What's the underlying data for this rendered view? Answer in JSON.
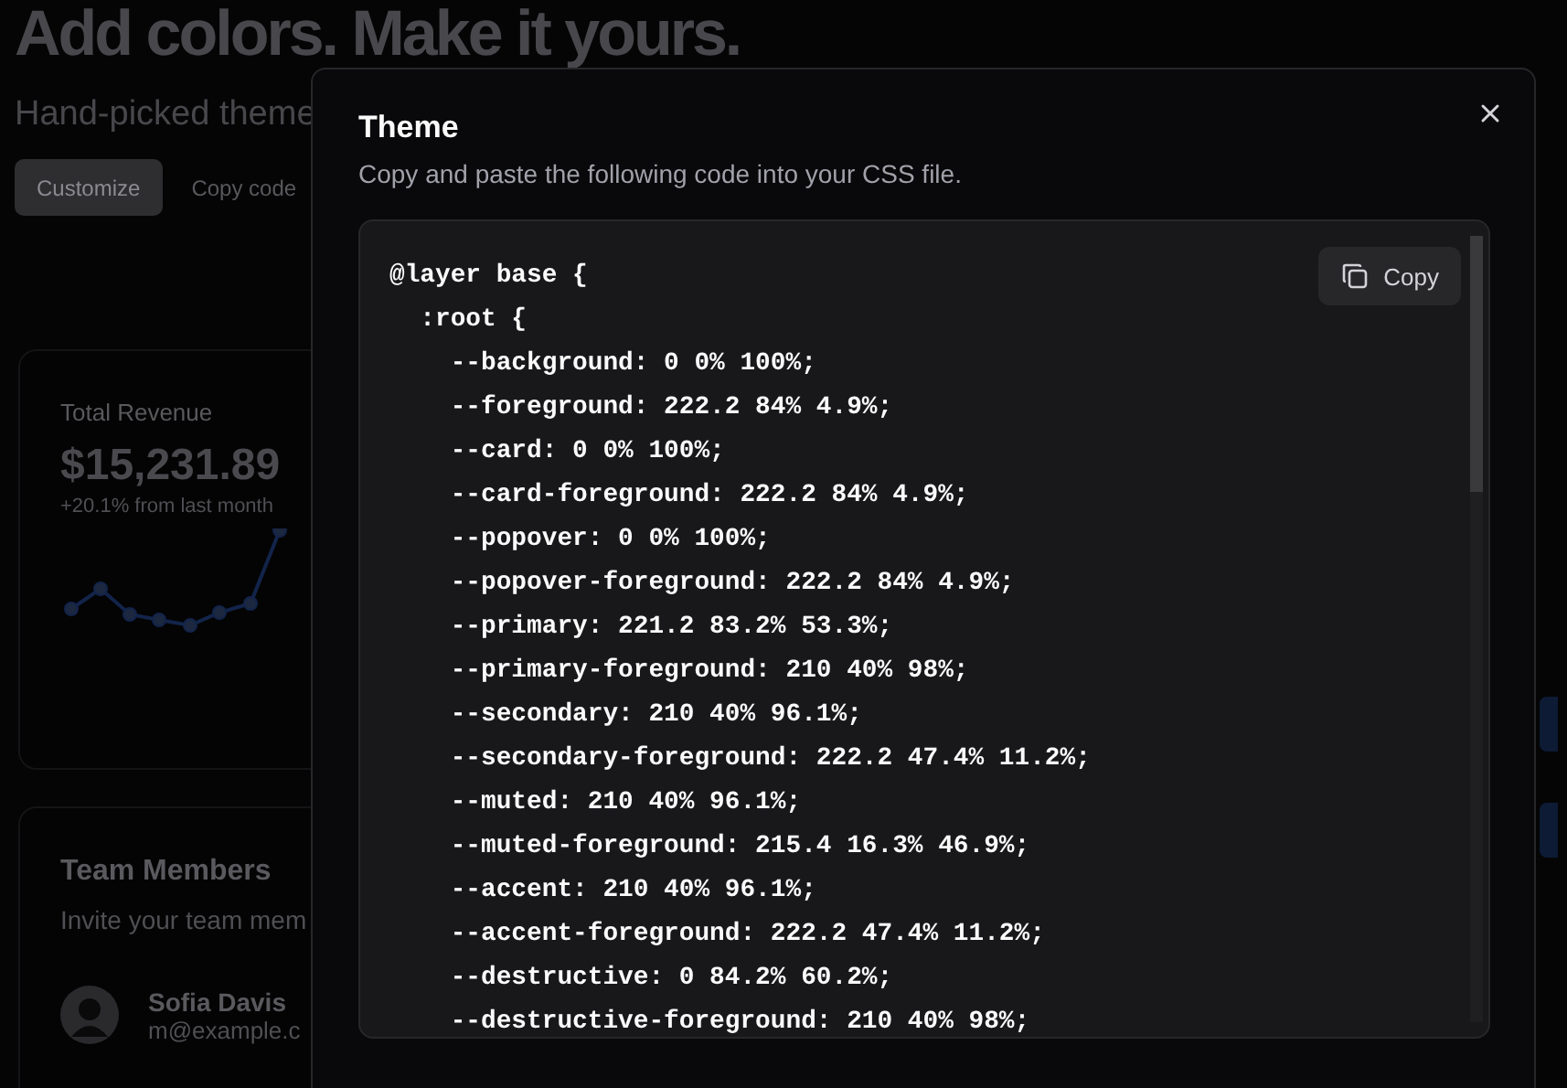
{
  "page": {
    "heading": "Add colors. Make it yours.",
    "subtitle": "Hand-picked theme",
    "buttons": [
      {
        "label": "Customize",
        "kind": "primary"
      },
      {
        "label": "Copy code",
        "kind": "ghost"
      }
    ]
  },
  "revenue_card": {
    "title": "Total Revenue",
    "value": "$15,231.89",
    "change": "+20.1% from last month"
  },
  "team_card": {
    "title": "Team Members",
    "description": "Invite your team mem",
    "members": [
      {
        "name": "Sofia Davis",
        "email": "m@example.c"
      }
    ]
  },
  "dialog": {
    "title": "Theme",
    "description": "Copy and paste the following code into your CSS file.",
    "copy_button": "Copy",
    "code_lines": [
      "@layer base {",
      "  :root {",
      "    --background: 0 0% 100%;",
      "    --foreground: 222.2 84% 4.9%;",
      "    --card: 0 0% 100%;",
      "    --card-foreground: 222.2 84% 4.9%;",
      "    --popover: 0 0% 100%;",
      "    --popover-foreground: 222.2 84% 4.9%;",
      "    --primary: 221.2 83.2% 53.3%;",
      "    --primary-foreground: 210 40% 98%;",
      "    --secondary: 210 40% 96.1%;",
      "    --secondary-foreground: 222.2 47.4% 11.2%;",
      "    --muted: 210 40% 96.1%;",
      "    --muted-foreground: 215.4 16.3% 46.9%;",
      "    --accent: 210 40% 96.1%;",
      "    --accent-foreground: 222.2 47.4% 11.2%;",
      "    --destructive: 0 84.2% 60.2%;",
      "    --destructive-foreground: 210 40% 98%;"
    ]
  }
}
